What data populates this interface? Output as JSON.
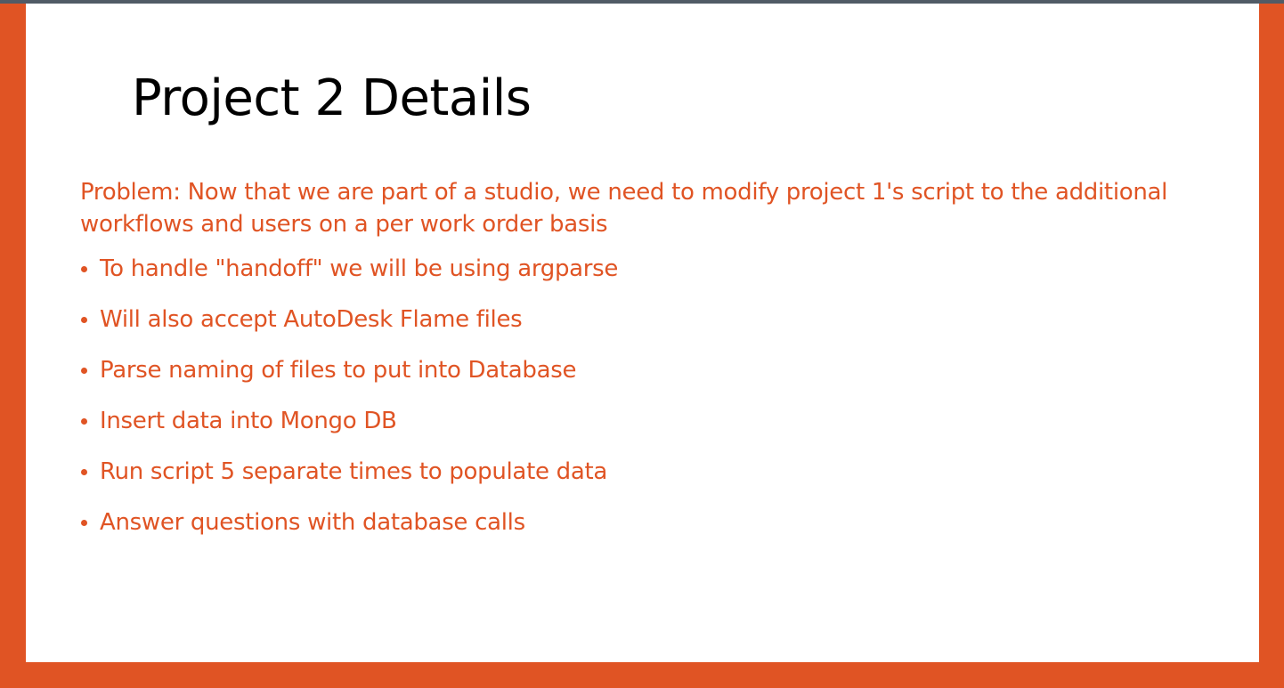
{
  "slide": {
    "title": "Project 2 Details",
    "problem": "Problem: Now that we are part of a studio, we need to modify project 1's script to the additional workflows and users on a per work order basis",
    "bullets": [
      "To handle \"handoff\" we will be using argparse",
      "Will also accept AutoDesk Flame files",
      "Parse naming of files to put into Database",
      "Insert data into Mongo DB",
      "Run script 5 separate times to populate data",
      "Answer questions with database calls"
    ]
  },
  "colors": {
    "accent": "#e05424",
    "top_bar": "#515b66",
    "slide_background": "#ffffff",
    "title_text": "#000000"
  }
}
